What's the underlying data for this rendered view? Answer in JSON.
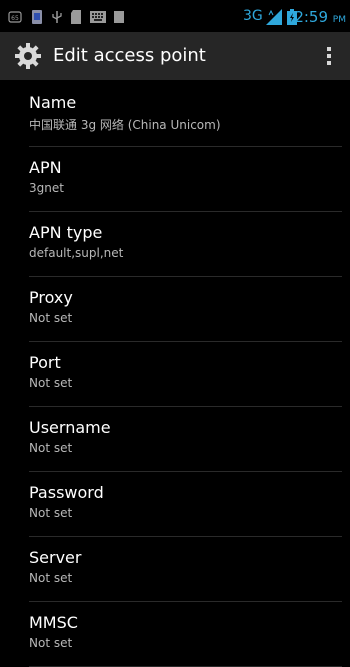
{
  "status_bar": {
    "network": "3G",
    "time": "2:59",
    "ampm": "PM",
    "time_color": "#2fa8dc",
    "icons": [
      "usb-debug-icon",
      "sim-icon",
      "usb-icon",
      "sd-card-icon",
      "keyboard-icon",
      "notification-icon",
      "signal-icon",
      "battery-icon"
    ]
  },
  "action_bar": {
    "title": "Edit access point",
    "icon": "gear-icon",
    "menu_icon": "overflow-menu-icon"
  },
  "fields": [
    {
      "title": "Name",
      "summary": "中国联通 3g 网络 (China Unicom)"
    },
    {
      "title": "APN",
      "summary": "3gnet"
    },
    {
      "title": "APN type",
      "summary": "default,supl,net"
    },
    {
      "title": "Proxy",
      "summary": "Not set"
    },
    {
      "title": "Port",
      "summary": "Not set"
    },
    {
      "title": "Username",
      "summary": "Not set"
    },
    {
      "title": "Password",
      "summary": "Not set"
    },
    {
      "title": "Server",
      "summary": "Not set"
    },
    {
      "title": "MMSC",
      "summary": "Not set"
    }
  ]
}
